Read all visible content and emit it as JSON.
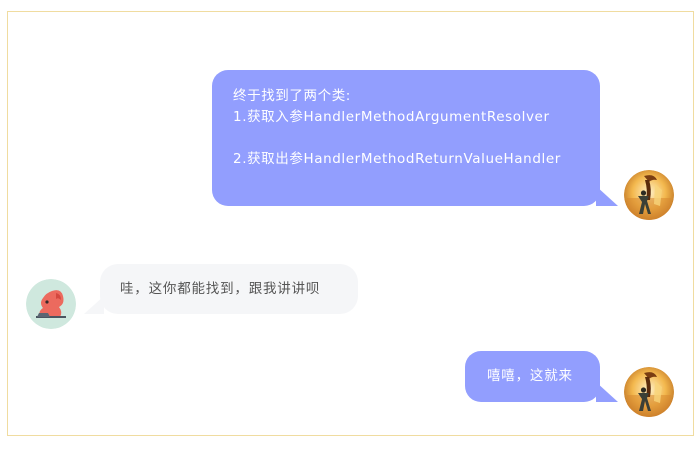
{
  "messages": [
    {
      "side": "right",
      "lines": [
        "终于找到了两个类:",
        "1.获取入参HandlerMethodArgumentResolver",
        "",
        "2.获取出参HandlerMethodReturnValueHandler"
      ]
    },
    {
      "side": "left",
      "text": "哇，这你都能找到，跟我讲讲呗"
    },
    {
      "side": "right",
      "text": "嘻嘻，这就来"
    }
  ],
  "avatars": {
    "right": "painting-avatar-icon",
    "left": "squirrel-avatar-icon"
  },
  "colors": {
    "right_bubble": "#929efe",
    "left_bubble": "#f5f6f8",
    "frame_border": "#f0dca0"
  }
}
